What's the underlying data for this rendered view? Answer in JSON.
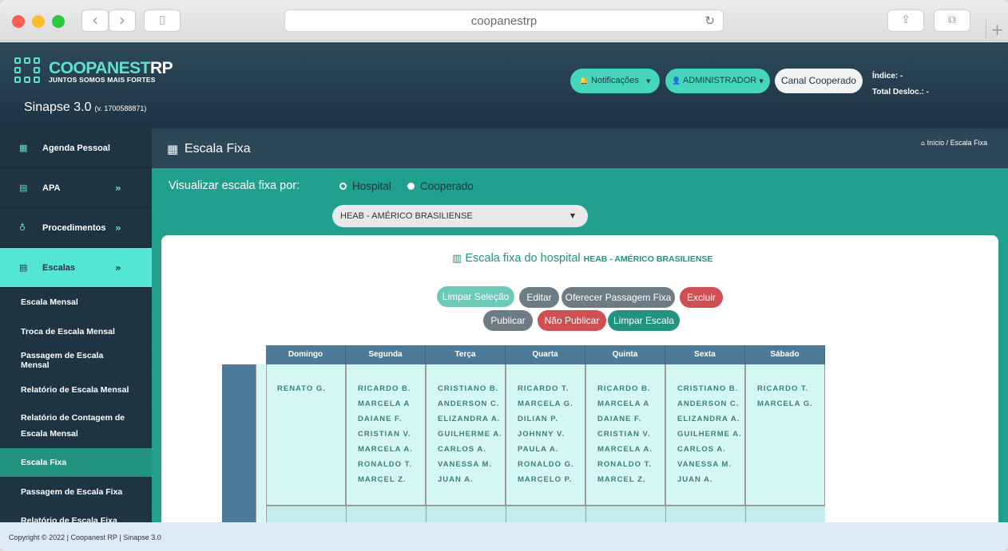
{
  "browser": {
    "url": "coopanestrp"
  },
  "header": {
    "brand_main": "COOPANEST",
    "brand_rp": "RP",
    "tagline": "JUNTOS SOMOS MAIS FORTES",
    "app_name": "Sinapse 3.0",
    "version": "(v. 1700588871)",
    "notifications": "Notificações",
    "user": "ADMINISTRADOR",
    "channel": "Canal Cooperado",
    "index_label": "Índice: -",
    "displacement_label": "Total Desloc.: -"
  },
  "sidebar": {
    "main": [
      {
        "label": "Agenda Pessoal",
        "icon": "table-icon"
      },
      {
        "label": "APA",
        "icon": "calendar-icon"
      },
      {
        "label": "Procedimentos",
        "icon": "stethoscope-icon"
      },
      {
        "label": "Escalas",
        "icon": "calendar-icon"
      }
    ],
    "sub": [
      "Escala Mensal",
      "Troca de Escala Mensal",
      "Passagem de Escala Mensal",
      "Relatório de Escala Mensal",
      "Relatório de Contagem de Escala Mensal",
      "Escala Fixa",
      "Passagem de Escala Fixa",
      "Relatório de Escala Fixa"
    ]
  },
  "page": {
    "title": "Escala Fixa",
    "breadcrumb": "Início / Escala Fixa"
  },
  "filter": {
    "label": "Visualizar escala fixa por:",
    "opt_hospital": "Hospital",
    "opt_cooperado": "Cooperado",
    "selected": "HEAB - AMÉRICO BRASILIENSE"
  },
  "card": {
    "title": "Escala fixa do hospital",
    "hospital": "HEAB - AMÉRICO BRASILIENSE"
  },
  "actions": {
    "limpar_selecao": "Limpar Seleção",
    "editar": "Editar",
    "oferecer": "Oferecer Passagem Fixa",
    "excluir": "Excluir",
    "publicar": "Publicar",
    "nao_publicar": "Não Publicar",
    "limpar_escala": "Limpar Escala"
  },
  "schedule": {
    "days": [
      "Domingo",
      "Segunda",
      "Terça",
      "Quarta",
      "Quinta",
      "Sexta",
      "Sábado"
    ],
    "names": [
      [
        "RENATO G."
      ],
      [
        "RICARDO B.",
        "MARCELA A",
        "DAIANE F.",
        "CRISTIAN V.",
        "MARCELA A.",
        "RONALDO T.",
        "MARCEL Z."
      ],
      [
        "CRISTIANO B.",
        "ANDERSON C.",
        "ELIZANDRA A.",
        "GUILHERME A.",
        "CARLOS A.",
        "VANESSA M.",
        "JUAN A."
      ],
      [
        "RICARDO T.",
        "MARCELA G.",
        "DILIAN P.",
        "JOHNNY V.",
        "PAULA A.",
        "RONALDO G.",
        "MARCELO P."
      ],
      [
        "RICARDO B.",
        "MARCELA A",
        "DAIANE F.",
        "CRISTIAN V.",
        "MARCELA A.",
        "RONALDO T.",
        "MARCEL Z."
      ],
      [
        "CRISTIANO B.",
        "ANDERSON C.",
        "ELIZANDRA A.",
        "GUILHERME A.",
        "CARLOS A.",
        "VANESSA M.",
        "JUAN A."
      ],
      [
        "RICARDO T.",
        "MARCELA G."
      ]
    ]
  },
  "footer": {
    "text": "Copyright © 2022 | Coopanest RP | Sinapse 3.0"
  }
}
